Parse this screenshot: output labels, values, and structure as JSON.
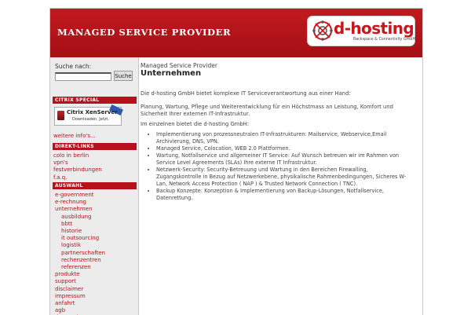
{
  "header": {
    "title": "MANAGED SERVICE PROVIDER"
  },
  "logo": {
    "brand": "d-hosting",
    "tagline": "Rackspace & Connectivity GmbH"
  },
  "search": {
    "label": "Suche nach:",
    "value": "",
    "button": "Suche"
  },
  "citrix": {
    "heading": "CITRIX SPECIAL",
    "banner_title": "Citrix XenServer",
    "banner_sub": "Downloaden. Jetzt.",
    "more_link": "weitere info's..."
  },
  "direct_links": {
    "heading": "DIREKT-LINKS",
    "items": [
      "colo in berlin",
      "vpn's",
      "festverbindungen",
      "f.a.q."
    ]
  },
  "auswahl": {
    "heading": "AUSWAHL",
    "items": [
      {
        "label": "e-government",
        "level": 1
      },
      {
        "label": "e-rechnung",
        "level": 1
      },
      {
        "label": "unternehmen",
        "level": 1
      },
      {
        "label": "ausbildung",
        "level": 2
      },
      {
        "label": "bbtt",
        "level": 2
      },
      {
        "label": "historie",
        "level": 2
      },
      {
        "label": "it outsourcing",
        "level": 2
      },
      {
        "label": "logistik",
        "level": 2
      },
      {
        "label": "partnerschaften",
        "level": 2
      },
      {
        "label": "rechenzentren",
        "level": 2
      },
      {
        "label": "referenzen",
        "level": 2
      },
      {
        "label": "produkte",
        "level": 1
      },
      {
        "label": "support",
        "level": 1
      },
      {
        "label": "disclaimer",
        "level": 1
      },
      {
        "label": "impressum",
        "level": 1
      },
      {
        "label": "anfahrt",
        "level": 1
      },
      {
        "label": "agb",
        "level": 1
      },
      {
        "label": "datenschutz",
        "level": 1
      }
    ]
  },
  "content": {
    "breadcrumb": "Managed Service Provider",
    "title": "Unternehmen",
    "intro": "Die d-hosting GmbH bietet komplexe IT Serviceverantwortung aus einer Hand:",
    "para2": "Planung, Wartung, Pflege und Weiterentwicklung für ein Höchstmass an Leistung, Komfort und Sicherheit Ihrer externen IT-Infrastruktur.",
    "para3": "Im einzelnen bietet die d-hosting GmbH:",
    "features": [
      "Implementierung von prozessneutralen IT-Infrastrukturen: Mailservice, Webservice,Email Archivierung, DNS, VPN.",
      "Managed Service, Colocation, WEB 2.0 Plattformen.",
      "Wartung, Notfallservice und allgemeiner IT Service: Auf Wunsch betreuen wir im Rahmen von Service Level Agreements (SLAs) Ihre externe IT Infrastruktur.",
      "Netzwerk-Security: Security-Betreuung und Wartung in den Bereichen Firewalling, Zugangskontrolle in Bezug auf Netzwerkebene, physikalische Rahmenbedingungen, Sicheres W-Lan, Network Access Protection ( NAP ) & Trusted Network Connection ( TNC).",
      "Backup Konzepte: Konzeption & Implementierung von Backup-Lösungen, Notfallservice, Datenrettung."
    ]
  },
  "colors": {
    "brand_red": "#b5121b",
    "header_red": "#c21a20",
    "sidebar_bg": "#ececec"
  }
}
